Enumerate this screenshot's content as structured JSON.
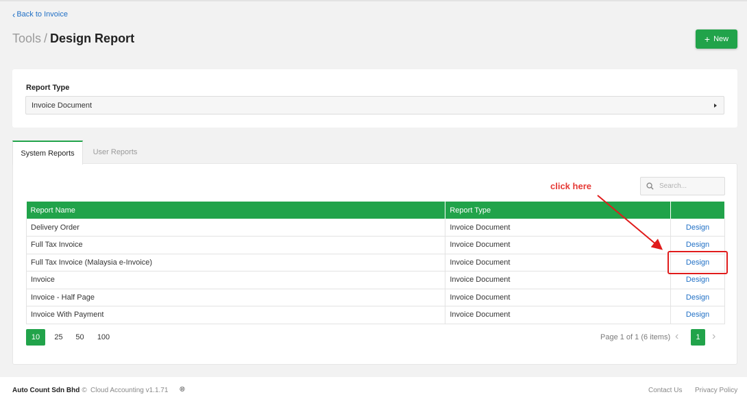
{
  "nav": {
    "back_label": "Back to Invoice"
  },
  "header": {
    "crumb": "Tools",
    "separator": "/",
    "title": "Design Report",
    "new_label": "New"
  },
  "filter": {
    "label": "Report Type",
    "selected": "Invoice Document"
  },
  "tabs": [
    {
      "label": "System Reports",
      "active": true
    },
    {
      "label": "User Reports",
      "active": false
    }
  ],
  "search": {
    "placeholder": "Search..."
  },
  "table": {
    "columns": [
      "Report Name",
      "Report Type",
      ""
    ],
    "rows": [
      {
        "name": "Delivery Order",
        "type": "Invoice Document",
        "action": "Design"
      },
      {
        "name": "Full Tax Invoice",
        "type": "Invoice Document",
        "action": "Design"
      },
      {
        "name": "Full Tax Invoice (Malaysia e-Invoice)",
        "type": "Invoice Document",
        "action": "Design"
      },
      {
        "name": "Invoice",
        "type": "Invoice Document",
        "action": "Design"
      },
      {
        "name": "Invoice - Half Page",
        "type": "Invoice Document",
        "action": "Design"
      },
      {
        "name": "Invoice With Payment",
        "type": "Invoice Document",
        "action": "Design"
      }
    ]
  },
  "pagination": {
    "sizes": [
      "10",
      "25",
      "50",
      "100"
    ],
    "info": "Page 1 of 1 (6 items)",
    "current": "1"
  },
  "footer": {
    "company": "Auto Count Sdn Bhd",
    "copyright": "©",
    "version": "Cloud Accounting v1.1.71",
    "contact": "Contact Us",
    "privacy": "Privacy Policy"
  },
  "annotation": {
    "text": "click here"
  },
  "colors": {
    "accent": "#21a34a",
    "link": "#1f6fc5",
    "annotation": "#e01b1b"
  }
}
